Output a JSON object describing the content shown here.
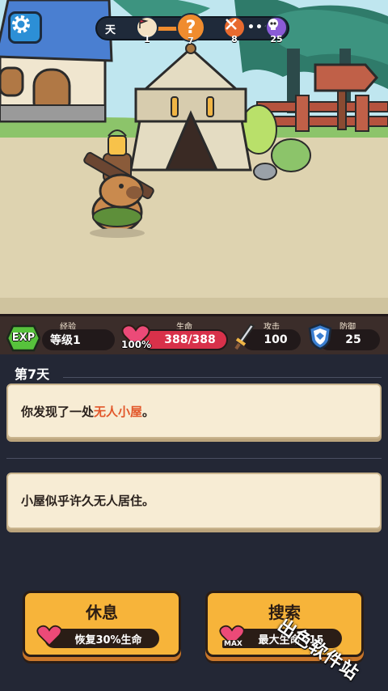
{
  "top_bar": {
    "day_prefix": "天",
    "nodes": [
      {
        "icon": "flag-icon",
        "count": "1",
        "color": "#f4e2c4"
      },
      {
        "icon": "question-icon",
        "count": "7",
        "color": "#f08c2e"
      },
      {
        "icon": "swords-icon",
        "count": "8",
        "color": "#e86a2e"
      },
      {
        "icon": "skull-icon",
        "count": "25",
        "color": "#8a5bd6"
      }
    ],
    "ellipsis": "•••"
  },
  "stats": {
    "exp_badge": "EXP",
    "exp_label": "经验",
    "level": "等级1",
    "hp_label": "生命",
    "hp_percent": "100%",
    "hp_value": "388/388",
    "hp_fill_fraction": 1.0,
    "attack_label": "攻击",
    "attack_value": "100",
    "defense_label": "防御",
    "defense_value": "25"
  },
  "log": {
    "day_title": "第7天",
    "entries": [
      {
        "before": "你发现了一处",
        "highlight": "无人小屋",
        "after": "。"
      },
      {
        "text": "小屋似乎许久无人居住。"
      }
    ]
  },
  "actions": {
    "rest": {
      "title": "休息",
      "sub": "恢复30%生命"
    },
    "search": {
      "title": "搜索",
      "sub": "最大生命+15",
      "tag": "MAX"
    }
  },
  "watermark": "出色软件站",
  "colors": {
    "accent": "#f7b43a",
    "hp": "#d8314a",
    "highlight": "#e2572a",
    "card": "#f7ecd4"
  }
}
